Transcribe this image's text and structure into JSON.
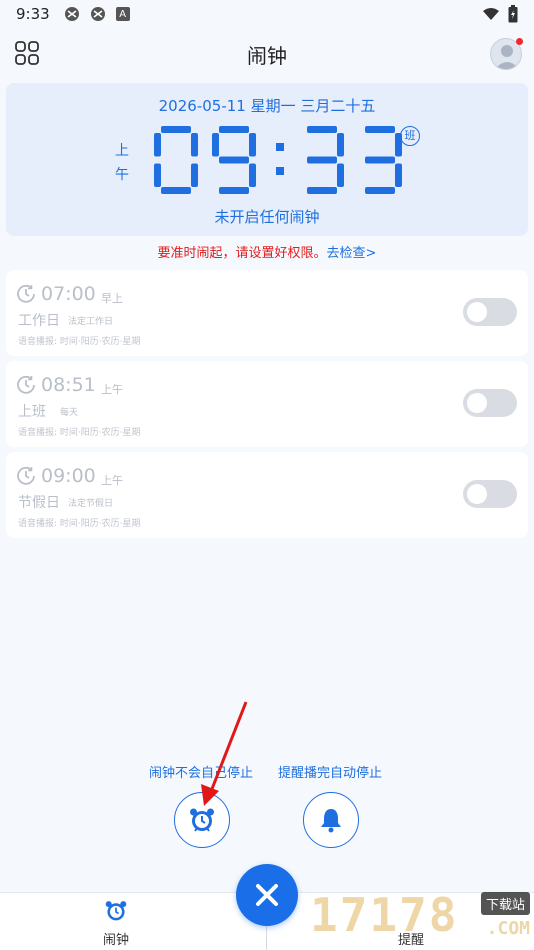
{
  "status_bar": {
    "time": "9:33",
    "badge_letter": "A"
  },
  "header": {
    "title": "闹钟"
  },
  "clock": {
    "date": "2026-05-11 星期一 三月二十五",
    "ampm_top": "上",
    "ampm_bottom": "午",
    "digits": "09:33",
    "workday_badge": "班",
    "status": "未开启任何闹钟"
  },
  "warning": {
    "text": "要准时闹起，请设置好权限。",
    "link": "去检查>"
  },
  "alarms": [
    {
      "time": "07:00",
      "period": "早上",
      "name": "工作日",
      "repeat": "法定工作日",
      "voice": "语音播报: 时间·阳历·农历·星期",
      "enabled": false
    },
    {
      "time": "08:51",
      "period": "上午",
      "name": "上班",
      "repeat": "每天",
      "voice": "语音播报: 时间·阳历·农历·星期",
      "enabled": false
    },
    {
      "time": "09:00",
      "period": "上午",
      "name": "节假日",
      "repeat": "法定节假日",
      "voice": "语音播报: 时间·阳历·农历·星期",
      "enabled": false
    }
  ],
  "modes": {
    "left_label": "闹钟不会自己停止",
    "right_label": "提醒播完自动停止"
  },
  "bottom_nav": {
    "alarm_label": "闹钟",
    "remind_label": "提醒"
  },
  "watermark": {
    "digits": "17178",
    "badge": "下载站",
    "domain": ".COM"
  },
  "colors": {
    "accent": "#1f6fe0",
    "warning": "#e21d1d",
    "fab": "#1a6fe8"
  }
}
